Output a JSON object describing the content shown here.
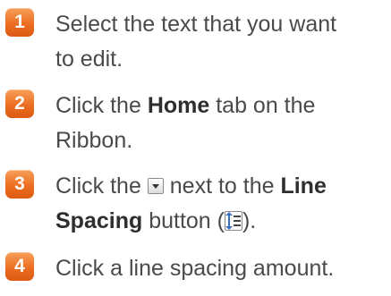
{
  "steps": [
    {
      "number": "1",
      "line1": "Select the text that you want",
      "line2": "to edit."
    },
    {
      "number": "2",
      "prefix": "Click the ",
      "bold": "Home",
      "suffix": " tab on the",
      "line2": "Ribbon."
    },
    {
      "number": "3",
      "prefix": "Click the ",
      "middle": " next to the ",
      "bold1": "Line",
      "bold2": "Spacing",
      "suffix_open": " button (",
      "suffix_close": ")."
    },
    {
      "number": "4",
      "line1": "Click a line spacing amount."
    }
  ],
  "icons": {
    "dropdown": "dropdown-arrow-icon",
    "line_spacing": "line-spacing-icon"
  },
  "colors": {
    "badge": "#ec6e22",
    "text": "#4a4a4a"
  }
}
